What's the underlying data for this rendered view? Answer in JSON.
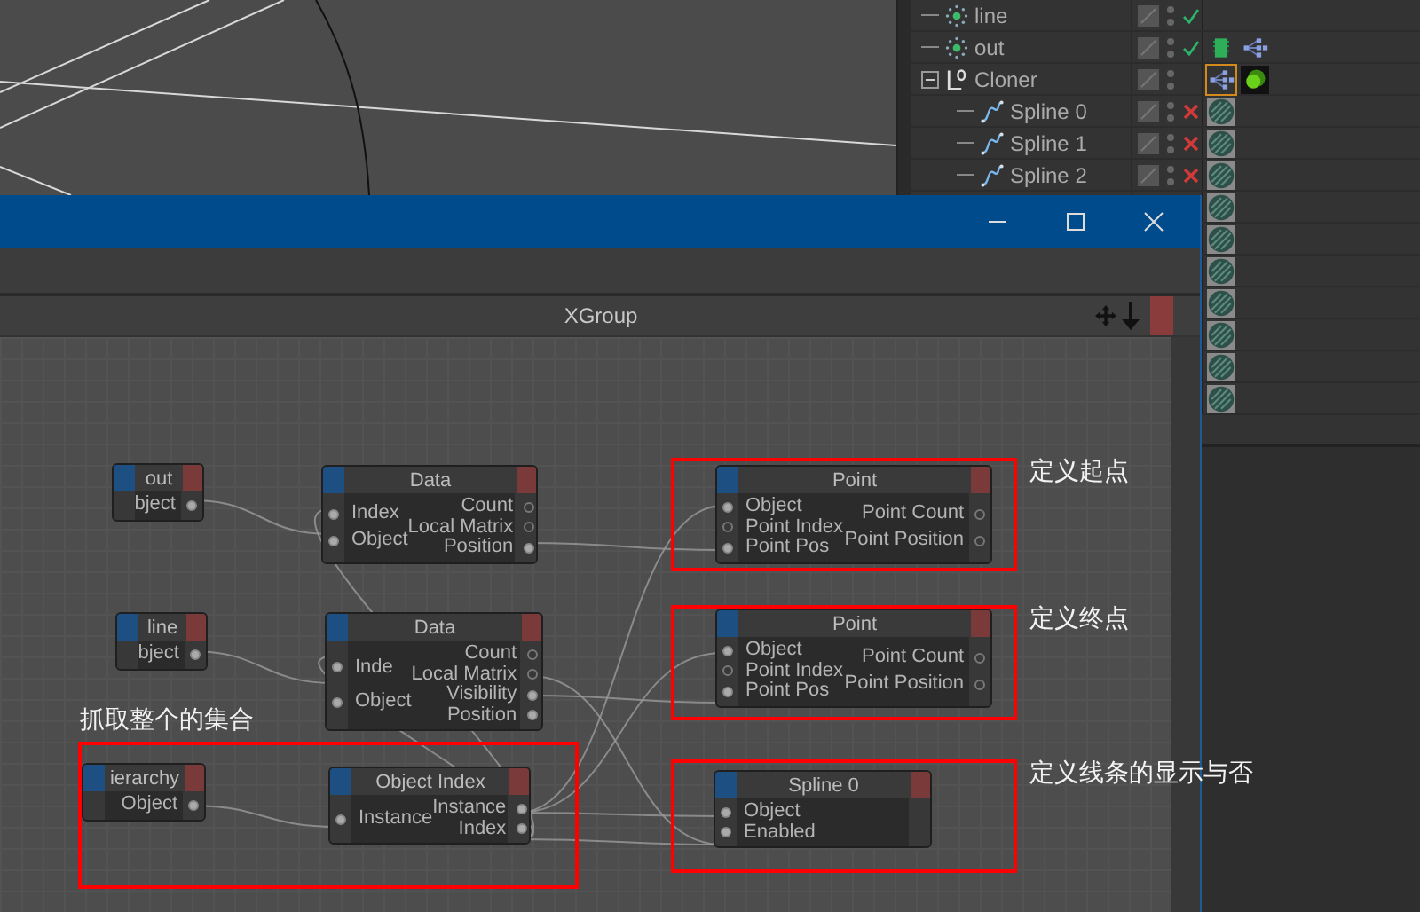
{
  "object_manager": {
    "objects": [
      {
        "name": "line",
        "kind": "null",
        "enabled": true
      },
      {
        "name": "out",
        "kind": "null",
        "enabled": true,
        "tags": [
          {
            "kind": "display",
            "selected": false
          },
          {
            "kind": "hierarchy",
            "selected": false
          }
        ]
      },
      {
        "name": "Cloner",
        "kind": "cloner",
        "expanded": true,
        "tags": [
          {
            "kind": "hierarchy",
            "selected": true
          },
          {
            "kind": "sphere",
            "selected": false
          }
        ],
        "children": [
          {
            "name": "Spline 0",
            "kind": "spline",
            "enabled": false,
            "tags": [
              {
                "kind": "texture",
                "selected": false
              }
            ]
          },
          {
            "name": "Spline 1",
            "kind": "spline",
            "enabled": false,
            "tags": [
              {
                "kind": "texture",
                "selected": false
              }
            ]
          },
          {
            "name": "Spline 2",
            "kind": "spline",
            "enabled": false,
            "tags": [
              {
                "kind": "texture",
                "selected": false
              }
            ]
          }
        ]
      }
    ],
    "covered_rows": [
      {
        "tags": [
          {
            "kind": "texture",
            "selected": false
          }
        ]
      },
      {
        "tags": [
          {
            "kind": "texture",
            "selected": false
          }
        ]
      },
      {
        "tags": [
          {
            "kind": "texture",
            "selected": false
          }
        ]
      },
      {
        "tags": [
          {
            "kind": "texture",
            "selected": false
          }
        ]
      },
      {
        "tags": [
          {
            "kind": "texture",
            "selected": false
          }
        ]
      },
      {
        "tags": [
          {
            "kind": "texture",
            "selected": false
          }
        ]
      },
      {
        "tags": [
          {
            "kind": "texture",
            "selected": false
          }
        ]
      }
    ]
  },
  "xpresso": {
    "title": "XGroup",
    "nodes": [
      {
        "title": "out",
        "outputs": [
          {
            "name": "bject",
            "connected": true
          }
        ]
      },
      {
        "title": "Data",
        "inputs": [
          {
            "name": "Index",
            "connected": true
          },
          {
            "name": "Object",
            "connected": true
          }
        ],
        "outputs": [
          {
            "name": "Count",
            "connected": false
          },
          {
            "name": "Local Matrix",
            "connected": false
          },
          {
            "name": "Position",
            "connected": true
          }
        ]
      },
      {
        "title": "Point",
        "inputs": [
          {
            "name": "Object",
            "connected": true
          },
          {
            "name": "Point Index",
            "connected": false
          },
          {
            "name": "Point Pos",
            "connected": true
          }
        ],
        "outputs": [
          {
            "name": "Point Count",
            "connected": false
          },
          {
            "name": "Point Position",
            "connected": false
          }
        ]
      },
      {
        "title": "line",
        "outputs": [
          {
            "name": "bject",
            "connected": true
          }
        ]
      },
      {
        "title": "Data",
        "inputs": [
          {
            "name": "Inde",
            "connected": true
          },
          {
            "name": "Object",
            "connected": true
          }
        ],
        "outputs": [
          {
            "name": "Count",
            "connected": false
          },
          {
            "name": "Local Matrix",
            "connected": false
          },
          {
            "name": "Visibility",
            "connected": true
          },
          {
            "name": "Position",
            "connected": true
          }
        ]
      },
      {
        "title": "Point",
        "inputs": [
          {
            "name": "Object",
            "connected": true
          },
          {
            "name": "Point Index",
            "connected": false
          },
          {
            "name": "Point Pos",
            "connected": true
          }
        ],
        "outputs": [
          {
            "name": "Point Count",
            "connected": false
          },
          {
            "name": "Point Position",
            "connected": false
          }
        ]
      },
      {
        "title": "ierarchy",
        "outputs": [
          {
            "name": "Object",
            "connected": true
          }
        ]
      },
      {
        "title": "Object Index",
        "inputs": [
          {
            "name": "Instance",
            "connected": true
          }
        ],
        "outputs": [
          {
            "name": "Instance",
            "connected": true
          },
          {
            "name": "Index",
            "connected": true
          }
        ]
      },
      {
        "title": "Spline 0",
        "inputs": [
          {
            "name": "Object",
            "connected": true
          },
          {
            "name": "Enabled",
            "connected": true
          }
        ]
      }
    ]
  },
  "annotations": [
    {
      "label": "定义起点"
    },
    {
      "label": "定义终点"
    },
    {
      "label": "定义线条的显示与否"
    },
    {
      "label": "抓取整个的集合"
    }
  ]
}
